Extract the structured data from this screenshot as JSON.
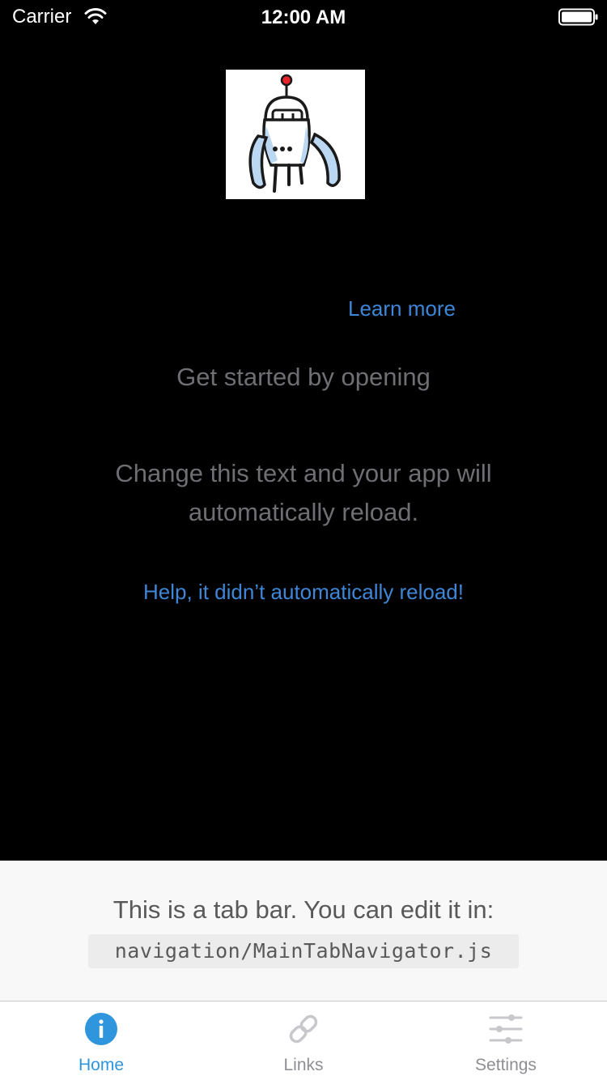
{
  "status_bar": {
    "carrier": "Carrier",
    "time": "12:00 AM",
    "wifi_icon": "wifi-icon",
    "battery_icon": "battery-full-icon"
  },
  "logo": {
    "icon": "robot-icon"
  },
  "main": {
    "learn_more_link": "Learn more",
    "get_started_text": "Get started by opening",
    "change_text_lines": [
      "Change this text and your app will",
      "automatically reload."
    ],
    "help_link": "Help, it didn’t automatically reload!"
  },
  "tab_info": {
    "text": "This is a tab bar. You can edit it in:",
    "file_path": "navigation/MainTabNavigator.js"
  },
  "tab_bar": {
    "tabs": [
      {
        "label": "Home",
        "icon": "info-icon",
        "active": true
      },
      {
        "label": "Links",
        "icon": "link-icon",
        "active": false
      },
      {
        "label": "Settings",
        "icon": "sliders-icon",
        "active": false
      }
    ]
  },
  "colors": {
    "background": "#000000",
    "link": "#3f86d6",
    "body_text": "#6e6e73",
    "tab_active": "#2f95dc",
    "tab_inactive": "#8e8e93",
    "info_panel": "#f8f8f8"
  }
}
